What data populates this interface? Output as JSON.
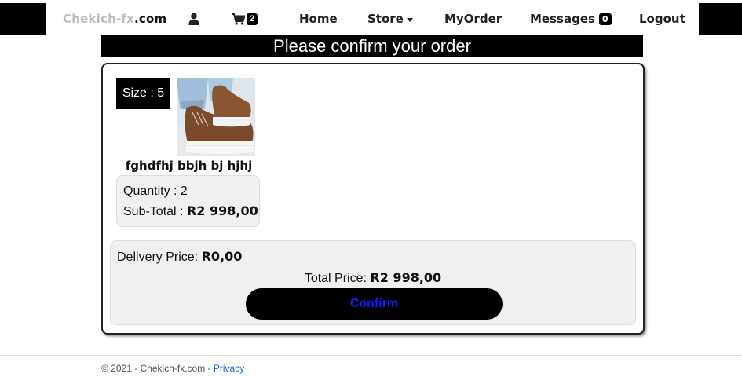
{
  "nav": {
    "brand_gray": "Chekich-fx",
    "brand_dark": ".com",
    "cart_count": "2",
    "home": "Home",
    "store": "Store",
    "myorder": "MyOrder",
    "messages": "Messages",
    "messages_count": "0",
    "logout": "Logout"
  },
  "page": {
    "title": "Please confirm your order"
  },
  "item": {
    "size_label": "Size : 5",
    "name": "fghdfhj bbjh bj hjhj",
    "quantity_label": "Quantity : 2",
    "subtotal_label": "Sub-Total :",
    "subtotal_value": "R2 998,00"
  },
  "summary": {
    "delivery_label": "Delivery Price:",
    "delivery_value": "R0,00",
    "total_label": "Total Price:",
    "total_value": "R2 998,00",
    "confirm_label": "Confirm"
  },
  "footer": {
    "copyright": "© 2021 - Chekich-fx.com - ",
    "privacy": "Privacy"
  },
  "colors": {
    "accent": "#000000",
    "confirm_text": "#1a1aff",
    "link": "#1a66cc"
  }
}
